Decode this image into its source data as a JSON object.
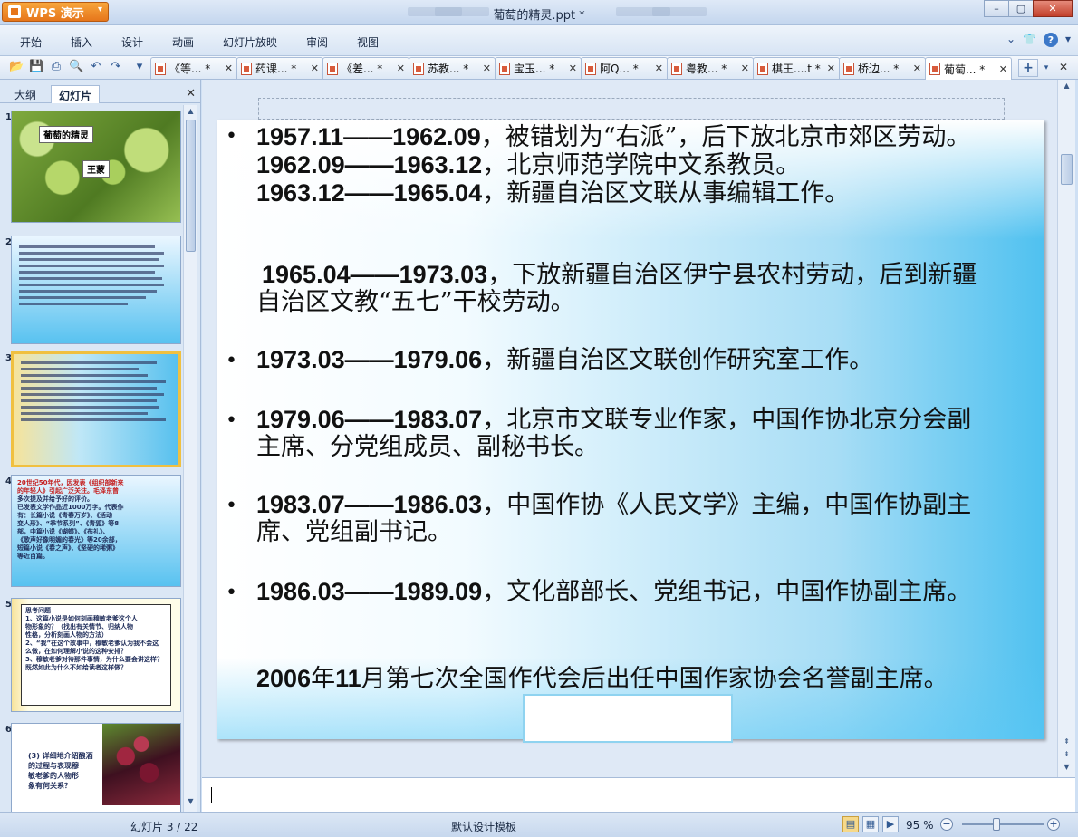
{
  "titlebar": {
    "app_button": "WPS 演示",
    "title": "葡萄的精灵.ppt *"
  },
  "menu": {
    "items": [
      "开始",
      "插入",
      "设计",
      "动画",
      "幻灯片放映",
      "审阅",
      "视图"
    ]
  },
  "tabs": [
    {
      "label": "《等... *"
    },
    {
      "label": "药课... *"
    },
    {
      "label": "《差... *"
    },
    {
      "label": "苏教... *"
    },
    {
      "label": "宝玉... *"
    },
    {
      "label": "阿Q... *"
    },
    {
      "label": "粤教... *"
    },
    {
      "label": "棋王....t *"
    },
    {
      "label": "桥边... *"
    },
    {
      "label": "葡萄... *"
    }
  ],
  "left_panel": {
    "tab_outline": "大纲",
    "tab_slides": "幻灯片",
    "thumbs": [
      {
        "num": "1",
        "title": "葡萄的精灵",
        "author": "王蒙"
      },
      {
        "num": "2"
      },
      {
        "num": "3"
      },
      {
        "num": "4",
        "lines": [
          "20世纪50年代，因发表《组织部新来",
          "的年轻人》引起广泛关注。毛泽东曾",
          "多次提及并给予好的评价。",
          "已发表文学作品近1000万字。代表作",
          "有：长篇小说《青春万岁》、《活动",
          "变人形》、“季节系列”、《青狐》等8",
          "部，中篇小说《蝴蝶》、《布礼》、",
          "《歌声好像明媚的春光》等20余部，",
          "短篇小说《春之声》、《坚硬的稀粥》",
          "等近百篇。"
        ]
      },
      {
        "num": "5",
        "lines": [
          "思考问题",
          "1、这篇小说是如何刻画穆敏老爹这个人",
          "物形象的？（找出有关情节、归纳人物",
          "性格，分析刻画人物的方法）",
          "2、“我”在这个故事中，穆敏老爹认为我不会这",
          "么做，在如何理解小说的这种安排？",
          "3、穆敏老爹对待那件事情，为什么要会讲这样？",
          "既然如此为什么不如给读者这样做？"
        ]
      },
      {
        "num": "6",
        "lines": [
          "(3) 详细地介绍酿酒",
          "的过程与表现穆",
          "敏老爹的人物形",
          "象有何关系？"
        ]
      }
    ]
  },
  "slide": {
    "paragraphs": [
      {
        "bold": "1957.11——1962.09",
        "text": "，被错划为“右派”，后下放北京市郊区劳动。"
      },
      {
        "bold": "1962.09——1963.12",
        "text": "，北京师范学院中文系教员。"
      },
      {
        "bold": "1963.12——1965.04",
        "text": "，新疆自治区文联从事编辑工作。"
      },
      {
        "bold": "1965.04——1973.03",
        "text": "，下放新疆自治区伊宁县农村劳动，后到新疆自治区文教“五七”干校劳动。"
      },
      {
        "bold": "1973.03——1979.06",
        "text": "，新疆自治区文联创作研究室工作。"
      },
      {
        "bold": "1979.06——1983.07",
        "text": "，北京市文联专业作家，中国作协北京分会副主席、分党组成员、副秘书长。"
      },
      {
        "bold": "1983.07——1986.03",
        "text": "，中国作协《人民文学》主编，中国作协副主席、党组副书记。"
      },
      {
        "bold": "1986.03——1989.09",
        "text": "，文化部部长、党组书记，中国作协副主席。"
      },
      {
        "bold": "2006",
        "text_a": "年",
        "bold_b": "11",
        "text": "月第七次全国作代会后出任中国作家协会名誉副主席。"
      }
    ]
  },
  "status": {
    "slide_indicator": "幻灯片 3 / 22",
    "template": "默认设计模板",
    "zoom": "95 %"
  },
  "colors": {
    "slide_gradient_end": "#4fc1f0",
    "wps_orange": "#e6761b",
    "selected_thumb_border": "#f0c040"
  }
}
